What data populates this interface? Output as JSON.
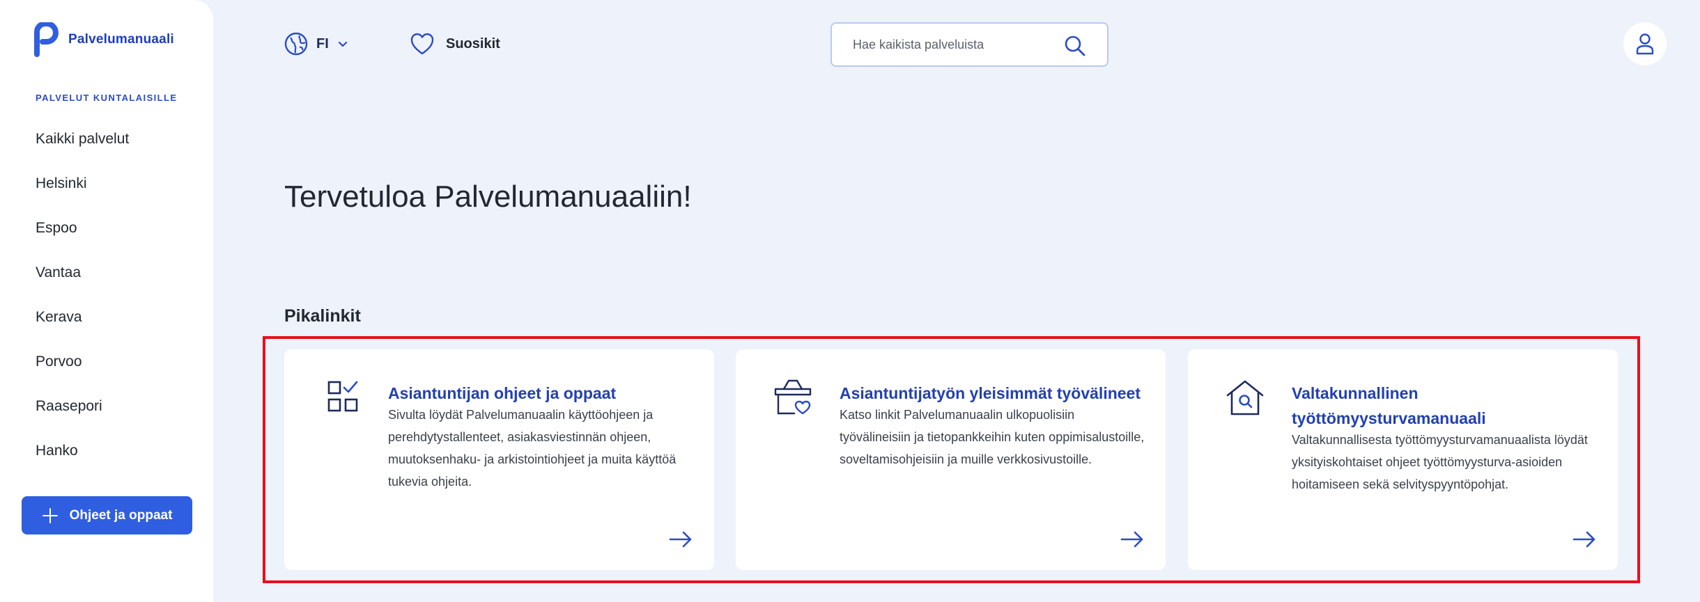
{
  "brand": {
    "name": "Palvelumanuaali",
    "accent": "#2f5ee0",
    "title_color": "#2240b0"
  },
  "sidebar": {
    "section_label": "PALVELUT KUNTALAISILLE",
    "items": [
      {
        "label": "Kaikki palvelut"
      },
      {
        "label": "Helsinki"
      },
      {
        "label": "Espoo"
      },
      {
        "label": "Vantaa"
      },
      {
        "label": "Kerava"
      },
      {
        "label": "Porvoo"
      },
      {
        "label": "Raasepori"
      },
      {
        "label": "Hanko"
      }
    ],
    "cta_label": "Ohjeet ja oppaat"
  },
  "header": {
    "language": "FI",
    "favorites_label": "Suosikit",
    "search_placeholder": "Hae kaikista palveluista"
  },
  "main": {
    "title": "Tervetuloa Palvelumanuaaliin!",
    "quicklinks_label": "Pikalinkit",
    "cards": [
      {
        "icon": "checklist-grid-icon",
        "title": "Asiantuntijan ohjeet ja oppaat",
        "description": "Sivulta löydät Palvelumanuaalin käyttöohjeen ja perehdytystallenteet, asiakasviestinnän ohjeen, muutoksenhaku- ja arkistointiohjeet ja muita käyttöä tukevia ohjeita."
      },
      {
        "icon": "basket-heart-icon",
        "title": "Asiantuntijatyön yleisimmät työvälineet",
        "description": "Katso linkit Palvelumanuaalin ulkopuolisiin työvälineisiin ja tietopankkeihin kuten oppimisalustoille, soveltamisohjeisiin ja muille verkkosivustoille."
      },
      {
        "icon": "house-search-icon",
        "title": "Valtakunnallinen työttömyysturvamanuaali",
        "description": "Valtakunnallisesta työttömyysturvamanuaalista löydät yksityiskohtaiset ohjeet työttömyysturva-asioiden hoitamiseen sekä selvityspyyntöpohjat."
      }
    ]
  }
}
